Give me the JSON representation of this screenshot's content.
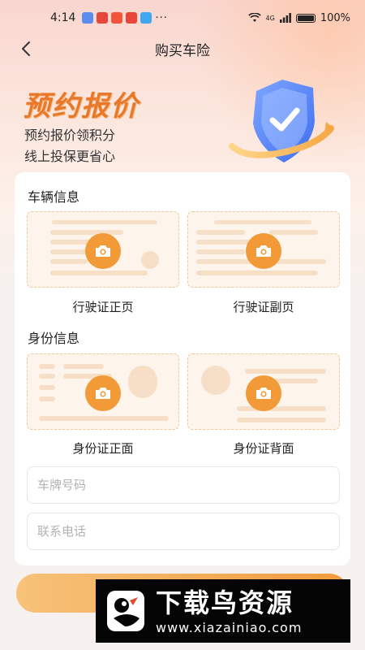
{
  "status_bar": {
    "time": "4:14",
    "more": "···",
    "network": "4G",
    "battery": "100%",
    "app_icons": [
      "#5b8def",
      "#e8463a",
      "#f3553b",
      "#e8463a",
      "#3fa6f0"
    ]
  },
  "nav": {
    "title": "购买车险"
  },
  "banner": {
    "title": "预约报价",
    "line1": "预约报价领积分",
    "line2": "线上投保更省心"
  },
  "vehicle": {
    "title": "车辆信息",
    "front_label": "行驶证正页",
    "back_label": "行驶证副页"
  },
  "identity": {
    "title": "身份信息",
    "front_label": "身份证正面",
    "back_label": "身份证背面"
  },
  "form": {
    "plate_placeholder": "车牌号码",
    "phone_placeholder": "联系电话"
  },
  "watermark": {
    "title": "下载鸟资源",
    "url": "www.xiazainiao.com"
  },
  "colors": {
    "accent": "#f29a38",
    "banner_title": "#e8792a"
  }
}
